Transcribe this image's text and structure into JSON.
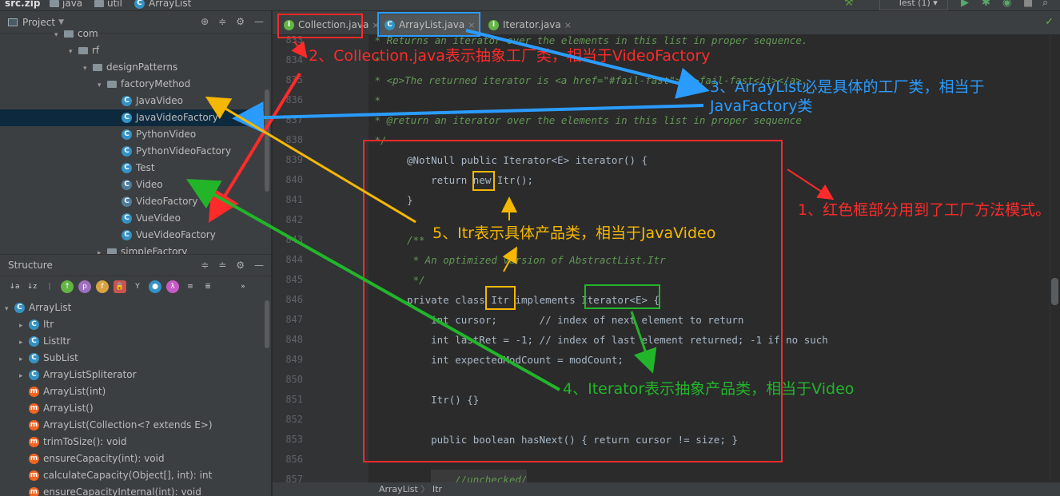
{
  "topbar": {
    "items": [
      "src.zip",
      "java",
      "util",
      "ArrayList"
    ],
    "run_config": "Test (1)"
  },
  "project_panel": {
    "title": "Project",
    "tree": [
      {
        "label": "com",
        "kind": "pkg",
        "level": 2,
        "arrow": "▾"
      },
      {
        "label": "rf",
        "kind": "pkg",
        "level": 3,
        "arrow": "▾"
      },
      {
        "label": "designPatterns",
        "kind": "pkg",
        "level": 4,
        "arrow": "▾"
      },
      {
        "label": "factoryMethod",
        "kind": "pkg",
        "level": 5,
        "arrow": "▾"
      },
      {
        "label": "JavaVideo",
        "kind": "class",
        "level": 6
      },
      {
        "label": "JavaVideoFactory",
        "kind": "class",
        "level": 6,
        "selected": true
      },
      {
        "label": "PythonVideo",
        "kind": "class",
        "level": 6
      },
      {
        "label": "PythonVideoFactory",
        "kind": "class",
        "level": 6
      },
      {
        "label": "Test",
        "kind": "class",
        "level": 6
      },
      {
        "label": "Video",
        "kind": "abstract",
        "level": 6
      },
      {
        "label": "VideoFactory",
        "kind": "abstract",
        "level": 6
      },
      {
        "label": "VueVideo",
        "kind": "class",
        "level": 6
      },
      {
        "label": "VueVideoFactory",
        "kind": "class",
        "level": 6
      },
      {
        "label": "simpleFactory",
        "kind": "pkg",
        "level": 5,
        "arrow": "▸"
      }
    ]
  },
  "structure_panel": {
    "title": "Structure",
    "tree": [
      {
        "label": "ArrayList",
        "kind": "class",
        "level": 0,
        "arrow": "▾"
      },
      {
        "label": "Itr",
        "kind": "class",
        "level": 1,
        "arrow": "▸"
      },
      {
        "label": "ListItr",
        "kind": "class",
        "level": 1,
        "arrow": "▸"
      },
      {
        "label": "SubList",
        "kind": "class",
        "level": 1,
        "arrow": "▸"
      },
      {
        "label": "ArrayListSpliterator",
        "kind": "class",
        "level": 1,
        "arrow": "▸"
      },
      {
        "label": "ArrayList(int)",
        "kind": "method",
        "level": 1
      },
      {
        "label": "ArrayList()",
        "kind": "method",
        "level": 1
      },
      {
        "label": "ArrayList(Collection<? extends E>)",
        "kind": "method",
        "level": 1
      },
      {
        "label": "trimToSize(): void",
        "kind": "method",
        "level": 1
      },
      {
        "label": "ensureCapacity(int): void",
        "kind": "method",
        "level": 1
      },
      {
        "label": "calculateCapacity(Object[], int): int",
        "kind": "method",
        "level": 1
      },
      {
        "label": "ensureCapacityInternal(int): void",
        "kind": "method",
        "level": 1
      }
    ]
  },
  "tabs": [
    {
      "label": "Collection.java",
      "icon": "I"
    },
    {
      "label": "ArrayList.java",
      "icon": "C",
      "active": true
    },
    {
      "label": "Iterator.java",
      "icon": "I"
    }
  ],
  "editor": {
    "line_numbers": [
      "833",
      "834",
      "835",
      "836",
      "837",
      "838",
      "839",
      "840",
      "841",
      "842",
      "843",
      "844",
      "845",
      "846",
      "847",
      "848",
      "849",
      "850",
      "851",
      "852",
      "853",
      "856",
      "857"
    ],
    "lines": [
      " * Returns an iterator over the elements in this list in proper sequence.",
      " *",
      " * <p>The returned iterator is <a href=\"#fail-fast\"><i>fail-fast</i></a>.",
      " *",
      " * @return an iterator over the elements in this list in proper sequence",
      " */",
      "@NotNull public Iterator<E> iterator() {",
      "    return new Itr();",
      "}",
      "",
      "/**",
      " * An optimized version of AbstractList.Itr",
      " */",
      "private class Itr implements Iterator<E> {",
      "    int cursor;       // index of next element to return",
      "    int lastRet = -1; // index of last element returned; -1 if no such",
      "    int expectedModCount = modCount;",
      "",
      "    Itr() {}",
      "",
      "    public boolean hasNext() { return cursor != size; }",
      "",
      "    //unchecked/"
    ]
  },
  "status_bar": {
    "crumb1": "ArrayList",
    "crumb2": "Itr"
  },
  "annotations": [
    {
      "id": "n1",
      "text": "1、红色框部分用到了工厂方法模式。",
      "color": "#ff2a2a"
    },
    {
      "id": "n2",
      "text": "2、Collection.java表示抽象工厂类，相当于VideoFactory",
      "color": "#ff2a2a"
    },
    {
      "id": "n3",
      "text": "3、ArrayList必是具体的工厂类，相当于JavaFactory类",
      "color": "#2b9cff"
    },
    {
      "id": "n4",
      "text": "4、Iterator表示抽象产品类，相当于Video",
      "color": "#22b52a"
    },
    {
      "id": "n5",
      "text": "5、Itr表示具体产品类，相当于JavaVideo",
      "color": "#f5b800"
    }
  ]
}
